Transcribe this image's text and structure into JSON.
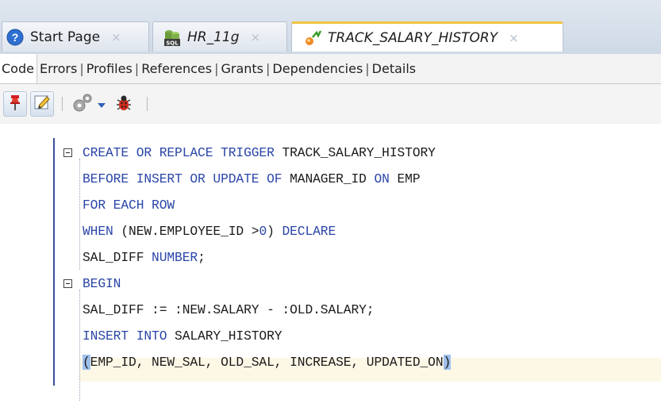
{
  "tabs": [
    {
      "label": "Start Page",
      "icon": "help-circle-icon",
      "state": "inactive",
      "close": "×"
    },
    {
      "label": "HR_11g",
      "icon": "sql-database-icon",
      "state": "inactive",
      "close": "×"
    },
    {
      "label": "TRACK_SALARY_HISTORY",
      "icon": "trigger-icon",
      "state": "active",
      "close": "×"
    }
  ],
  "subtabs": [
    "Code",
    "Errors",
    "Profiles",
    "References",
    "Grants",
    "Dependencies",
    "Details"
  ],
  "subtab_separator": "|",
  "toolbar": {
    "buttons": [
      "pin-icon",
      "edit-icon",
      "compile-gear-icon",
      "dropdown-arrow-icon",
      "debug-bug-icon"
    ]
  },
  "code": {
    "lines": [
      {
        "parts": [
          [
            "kw",
            "CREATE OR REPLACE TRIGGER "
          ],
          [
            "txt",
            "TRACK_SALARY_HISTORY"
          ]
        ]
      },
      {
        "parts": [
          [
            "kw",
            "BEFORE INSERT OR UPDATE OF "
          ],
          [
            "txt",
            "MANAGER_ID "
          ],
          [
            "kw",
            "ON "
          ],
          [
            "txt",
            "EMP"
          ]
        ]
      },
      {
        "parts": [
          [
            "kw",
            "FOR EACH ROW"
          ]
        ]
      },
      {
        "parts": [
          [
            "kw",
            "WHEN "
          ],
          [
            "txt",
            "(NEW.EMPLOYEE_ID >"
          ],
          [
            "num",
            "0"
          ],
          [
            "txt",
            ") "
          ],
          [
            "kw",
            "DECLARE"
          ]
        ]
      },
      {
        "parts": [
          [
            "txt",
            "SAL_DIFF "
          ],
          [
            "kw",
            "NUMBER"
          ],
          [
            "txt",
            ";"
          ]
        ]
      },
      {
        "parts": [
          [
            "kw",
            "BEGIN"
          ]
        ]
      },
      {
        "parts": [
          [
            "txt",
            "SAL_DIFF := :NEW.SALARY - :OLD.SALARY;"
          ]
        ]
      },
      {
        "parts": [
          [
            "kw",
            "INSERT INTO "
          ],
          [
            "txt",
            "SALARY_HISTORY"
          ]
        ]
      },
      {
        "parts": [
          [
            "bracket",
            "("
          ],
          [
            "txt",
            "EMP_ID, NEW_SAL, OLD_SAL, INCREASE, UPDATED_ON"
          ],
          [
            "bracket",
            ")"
          ]
        ]
      }
    ]
  },
  "colors": {
    "keyword": "#2a46a8",
    "text": "#1b1b1b",
    "active_tab_accent": "#f2c443",
    "current_line": "#fdf7e6"
  }
}
